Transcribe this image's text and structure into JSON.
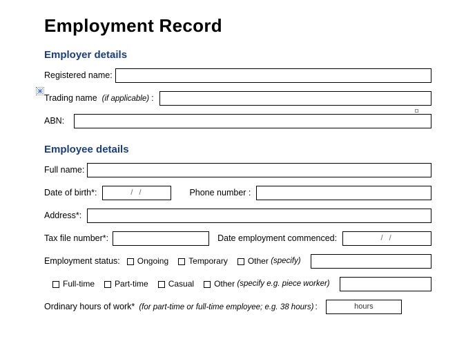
{
  "title": "Employment Record",
  "sections": {
    "employer": {
      "heading": "Employer details",
      "registeredName": {
        "label": "Registered name:",
        "value": ""
      },
      "tradingName": {
        "label": "Trading name",
        "hint": "(if applicable)",
        "suffix": ":",
        "value": ""
      },
      "abn": {
        "label": "ABN:",
        "value": ""
      }
    },
    "employee": {
      "heading": "Employee details",
      "fullName": {
        "label": "Full name:",
        "value": ""
      },
      "dob": {
        "label": "Date of birth*:",
        "placeholder": "/      /"
      },
      "phone": {
        "label": "Phone number  :",
        "value": ""
      },
      "address": {
        "label": "Address*:",
        "value": ""
      },
      "tfn": {
        "label": "Tax file number*:",
        "value": ""
      },
      "commenced": {
        "label": "Date employment commenced:",
        "placeholder": "/      /"
      },
      "status": {
        "label": "Employment status:",
        "options": [
          "Ongoing",
          "Temporary"
        ],
        "other": {
          "label": "Other",
          "hint": "(specify)",
          "value": ""
        }
      },
      "type": {
        "options": [
          "Full-time",
          "Part-time",
          "Casual"
        ],
        "other": {
          "label": "Other",
          "hint": "(specify e.g. piece worker)",
          "value": ""
        }
      },
      "hours": {
        "label": "Ordinary hours of work*",
        "hint": "(for part-time or full-time employee; e.g. 38 hours)",
        "suffix": ":",
        "unit": "hours",
        "value": ""
      }
    }
  }
}
